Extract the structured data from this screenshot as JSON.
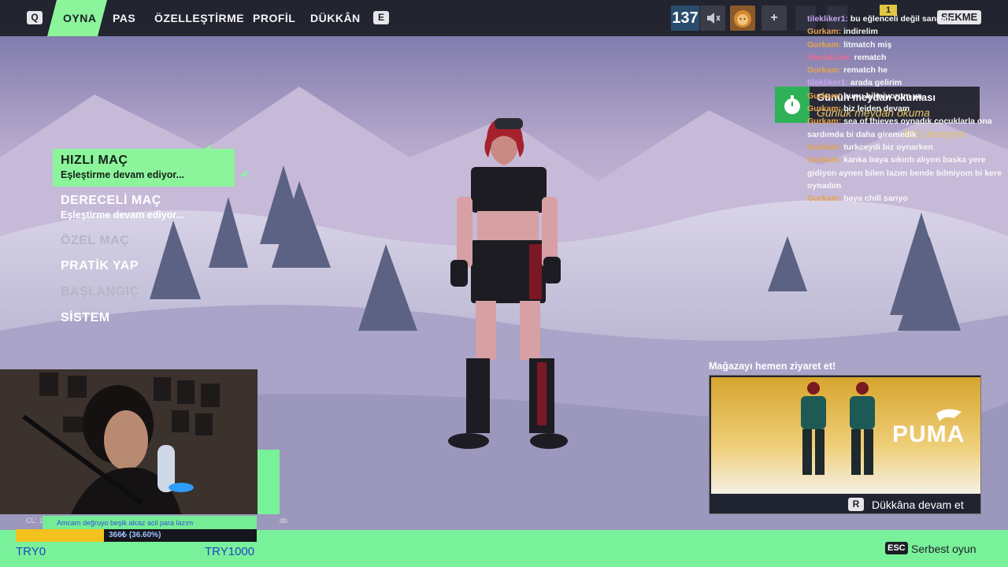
{
  "topbar": {
    "left_key": "Q",
    "right_key": "E",
    "tabs": [
      {
        "label": "OYNA"
      },
      {
        "label": "PAS"
      },
      {
        "label": "ÖZELLEŞTİRME"
      },
      {
        "label": "PROFİL"
      },
      {
        "label": "DÜKKÂN"
      }
    ],
    "level": "137",
    "mute_icon": "speaker-muted-icon",
    "avatar_icon": "lion-avatar-icon",
    "add_label": "+",
    "notification_count": "1",
    "tab_key_label": "SEKME"
  },
  "menu": {
    "items": [
      {
        "title": "HIZLI MAÇ",
        "subtitle": "Eşleştirme devam ediyor..."
      },
      {
        "title": "DERECELİ MAÇ",
        "subtitle": "Eşleştirme devam ediyor..."
      },
      {
        "title": "ÖZEL MAÇ"
      },
      {
        "title": "PRATİK YAP"
      },
      {
        "title": "BAŞLANGIÇ"
      },
      {
        "title": "SİSTEM"
      }
    ]
  },
  "daily": {
    "title": "Günün meydan okuması",
    "subtitle": "Günlük meydan okuma",
    "reward": "500 deneyim",
    "icon": "stopwatch-icon"
  },
  "chat": {
    "messages": [
      {
        "user": "tilekliker1",
        "text": "bu eğlenceli değil sanırım"
      },
      {
        "user": "Gurkam",
        "text": "indirelim"
      },
      {
        "user": "Gurkam",
        "text": "litmatch miş"
      },
      {
        "user": "HantalLive",
        "text": "rematch"
      },
      {
        "user": "Gurkam",
        "text": "rematch he"
      },
      {
        "user": "tilekliker1",
        "text": "arada gelirim"
      },
      {
        "user": "Gurkam",
        "text": "bunu bilmiyorum ya"
      },
      {
        "user": "Gurkam",
        "text": "biz leiden devam"
      },
      {
        "user": "Gurkam",
        "text": "sea of thieves oynadık cocuklarla ona sardımda bi daha giremedik"
      },
      {
        "user": "Gurkam",
        "text": "turkceydi biz oynarken"
      },
      {
        "user": "Gurkam",
        "text": "kanka baya sıkıntı alıyon baska yere gidiyon aynen bilen lazım bende bilmiyom bi kere oynadım"
      },
      {
        "user": "Gurkam",
        "text": "baya chill sarıyo"
      }
    ]
  },
  "store": {
    "title": "Mağazayı hemen ziyaret et!",
    "brand": "PUMA",
    "cta_key": "R",
    "cta_label": "Dükkâna devam et"
  },
  "stream": {
    "cl_label": "CL: 1",
    "donation_text": "Amcam değruyo beşik alcaz acil para lazım",
    "goal_text": "366₺ (36.60%)",
    "goal_fraction": 0.366,
    "goal_left": "TRY0",
    "goal_right": "TRY1000",
    "ndb_text": "db"
  },
  "footer": {
    "esc_key": "ESC",
    "esc_label": "Serbest oyun"
  },
  "colors": {
    "accent_green": "#8cf59c",
    "gold": "#f3c21d",
    "chat_user": "#e6a34c"
  }
}
